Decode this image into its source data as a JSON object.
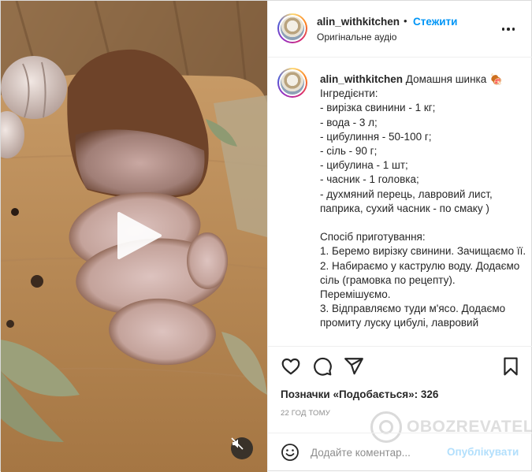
{
  "header": {
    "username": "alin_withkitchen",
    "separator": "•",
    "follow_label": "Стежити",
    "audio_label": "Оригінальне аудіо",
    "more_icon": "more-horizontal-icon"
  },
  "caption": {
    "username": "alin_withkitchen",
    "text": " Домашня шинка 🍖\nІнгредієнти:\n- вирізка свинини - 1 кг;\n- вода - 3 л;\n- цибулиння - 50-100 г;\n- сіль - 90 г;\n- цибулина - 1 шт;\n- часник - 1 головка;\n- духмяний перець, лавровий лист, паприка, сухий часник - по смаку )\n\nСпосіб приготування:\n1. Беремо вирізку свинини. Зачищаємо її.\n2. Набираємо у каструлю воду. Додаємо сіль (грамовка по рецепту). Перемішуємо.\n3. Відправляємо туди м'ясо. Додаємо промиту луску цибулі, лавровий"
  },
  "actions": {
    "icons": [
      "heart-icon",
      "comment-icon",
      "share-icon",
      "bookmark-icon"
    ],
    "likes_text": "Позначки «Подобається»: 326",
    "timestamp": "22 ГОД ТОМУ"
  },
  "watermark": {
    "text": "OBOZREVATEL"
  },
  "comment": {
    "placeholder": "Додайте коментар...",
    "publish_label": "Опублікувати",
    "publish_color": "#b2dffc"
  },
  "media": {
    "play_icon": "play-icon",
    "mute_icon": "muted-speaker-icon"
  },
  "colors": {
    "accent": "#0095f6",
    "text": "#262626",
    "muted": "#8e8e8e"
  }
}
